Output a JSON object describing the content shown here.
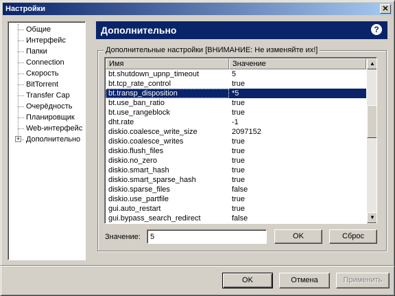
{
  "window": {
    "title": "Настройки",
    "close_label": "✕"
  },
  "tree": {
    "expander": "+",
    "items": [
      "Общие",
      "Интерфейс",
      "Папки",
      "Connection",
      "Скорость",
      "BitTorrent",
      "Transfer Cap",
      "Очерёдность",
      "Планировщик",
      "Web-интерфейс",
      "Дополнительно"
    ]
  },
  "header": {
    "title": "Дополнительно",
    "help_icon": "?"
  },
  "group": {
    "legend": "Дополнительные настройки [ВНИМАНИЕ: Не изменяйте их!]"
  },
  "table": {
    "columns": [
      "Имя",
      "Значение"
    ],
    "rows": [
      {
        "name": "bt.shutdown_upnp_timeout",
        "value": "5"
      },
      {
        "name": "bt.tcp_rate_control",
        "value": "true"
      },
      {
        "name": "bt.transp_disposition",
        "value": "*5",
        "selected": true
      },
      {
        "name": "bt.use_ban_ratio",
        "value": "true"
      },
      {
        "name": "bt.use_rangeblock",
        "value": "true"
      },
      {
        "name": "dht.rate",
        "value": "-1"
      },
      {
        "name": "diskio.coalesce_write_size",
        "value": "2097152"
      },
      {
        "name": "diskio.coalesce_writes",
        "value": "true"
      },
      {
        "name": "diskio.flush_files",
        "value": "true"
      },
      {
        "name": "diskio.no_zero",
        "value": "true"
      },
      {
        "name": "diskio.smart_hash",
        "value": "true"
      },
      {
        "name": "diskio.smart_sparse_hash",
        "value": "true"
      },
      {
        "name": "diskio.sparse_files",
        "value": "false"
      },
      {
        "name": "diskio.use_partfile",
        "value": "true"
      },
      {
        "name": "gui.auto_restart",
        "value": "true"
      },
      {
        "name": "gui.bypass_search_redirect",
        "value": "false"
      }
    ]
  },
  "editor": {
    "label": "Значение:",
    "value": "5",
    "ok_label": "OK",
    "reset_label": "Сброс"
  },
  "footer": {
    "ok_label": "OK",
    "cancel_label": "Отмена",
    "apply_label": "Применить"
  }
}
